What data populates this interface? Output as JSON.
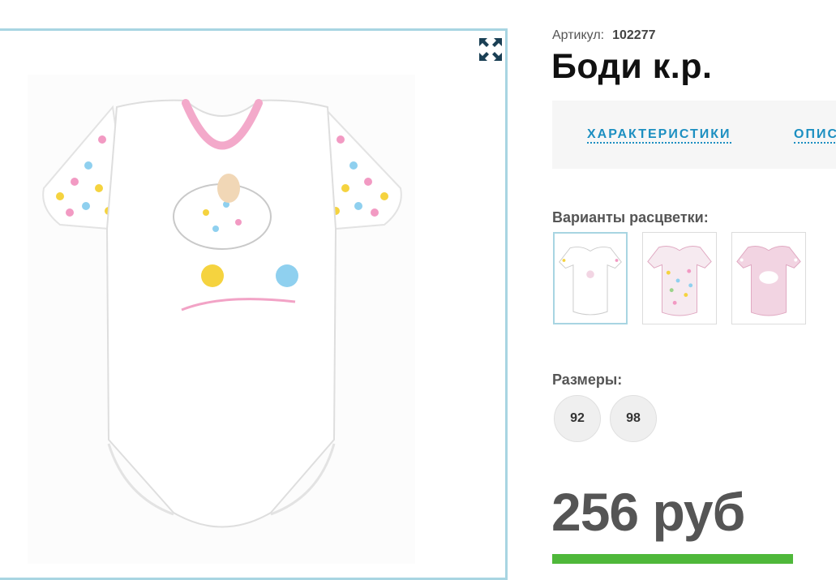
{
  "product": {
    "sku_label": "Артикул:",
    "sku_value": "102277",
    "title": "Боди к.р."
  },
  "tabs": [
    {
      "label": "ХАРАКТЕРИСТИКИ"
    },
    {
      "label": "ОПИС"
    }
  ],
  "variants": {
    "label": "Варианты расцветки:",
    "items": [
      {
        "name": "white with flowers",
        "selected": true
      },
      {
        "name": "pink print",
        "selected": false
      },
      {
        "name": "pink",
        "selected": false
      }
    ]
  },
  "sizes": {
    "label": "Размеры:",
    "items": [
      "92",
      "98"
    ]
  },
  "price": {
    "text": "256 руб"
  },
  "icons": {
    "expand": "expand-arrows-icon"
  },
  "colors": {
    "accent_border": "#a8d5e2",
    "tab_link": "#1c8fc1",
    "buy_button": "#4fb83a"
  }
}
